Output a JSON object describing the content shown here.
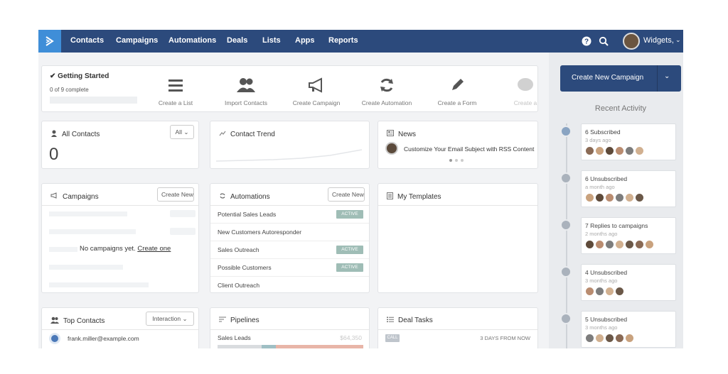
{
  "nav": {
    "items": [
      "Contacts",
      "Campaigns",
      "Automations",
      "Deals",
      "Lists",
      "Apps",
      "Reports"
    ],
    "account_label": "Widgets,"
  },
  "getting_started": {
    "title": "Getting Started",
    "progress_text": "0 of 9 complete",
    "progress_fraction": 0,
    "steps": [
      "Create a List",
      "Import Contacts",
      "Create Campaign",
      "Create Automation",
      "Create a Form",
      "Create a"
    ]
  },
  "all_contacts": {
    "title": "All Contacts",
    "filter": "All",
    "count": "0"
  },
  "contact_trend": {
    "title": "Contact Trend"
  },
  "news": {
    "title": "News",
    "headline": "Customize Your Email Subject with RSS Content",
    "pages": 3,
    "active_page": 1
  },
  "campaigns": {
    "title": "Campaigns",
    "button": "Create New",
    "empty_text": "No campaigns yet.",
    "empty_link": "Create one"
  },
  "automations": {
    "title": "Automations",
    "button": "Create New",
    "items": [
      {
        "name": "Potential Sales Leads",
        "status": "ACTIVE"
      },
      {
        "name": "New Customers Autoresponder",
        "status": ""
      },
      {
        "name": "Sales Outreach",
        "status": "ACTIVE"
      },
      {
        "name": "Possible Customers",
        "status": "ACTIVE"
      },
      {
        "name": "Client Outreach",
        "status": ""
      }
    ]
  },
  "templates": {
    "title": "My Templates"
  },
  "top_contacts": {
    "title": "Top Contacts",
    "sort": "Interaction",
    "items": [
      "frank.miller@example.com"
    ]
  },
  "pipelines": {
    "title": "Pipelines",
    "items": [
      {
        "name": "Sales Leads",
        "amount": "$64,350"
      }
    ]
  },
  "deal_tasks": {
    "title": "Deal Tasks",
    "items": [
      {
        "type": "CALL",
        "when": "3 DAYS FROM NOW"
      }
    ]
  },
  "create_campaign_button": "Create New Campaign",
  "recent_activity": {
    "title": "Recent Activity",
    "items": [
      {
        "title": "6 Subscribed",
        "time": "3 days ago",
        "avatars": 6
      },
      {
        "title": "6 Unsubscribed",
        "time": "a month ago",
        "avatars": 6
      },
      {
        "title": "7 Replies to campaigns",
        "time": "2 months ago",
        "avatars": 7
      },
      {
        "title": "4 Unsubscribed",
        "time": "3 months ago",
        "avatars": 4
      },
      {
        "title": "5 Unsubscribed",
        "time": "3 months ago",
        "avatars": 5
      }
    ]
  },
  "colors": {
    "nav_bg": "#2c4a7c",
    "logo_bg": "#3f8ed8",
    "badge_active": "#9fbdb6"
  }
}
